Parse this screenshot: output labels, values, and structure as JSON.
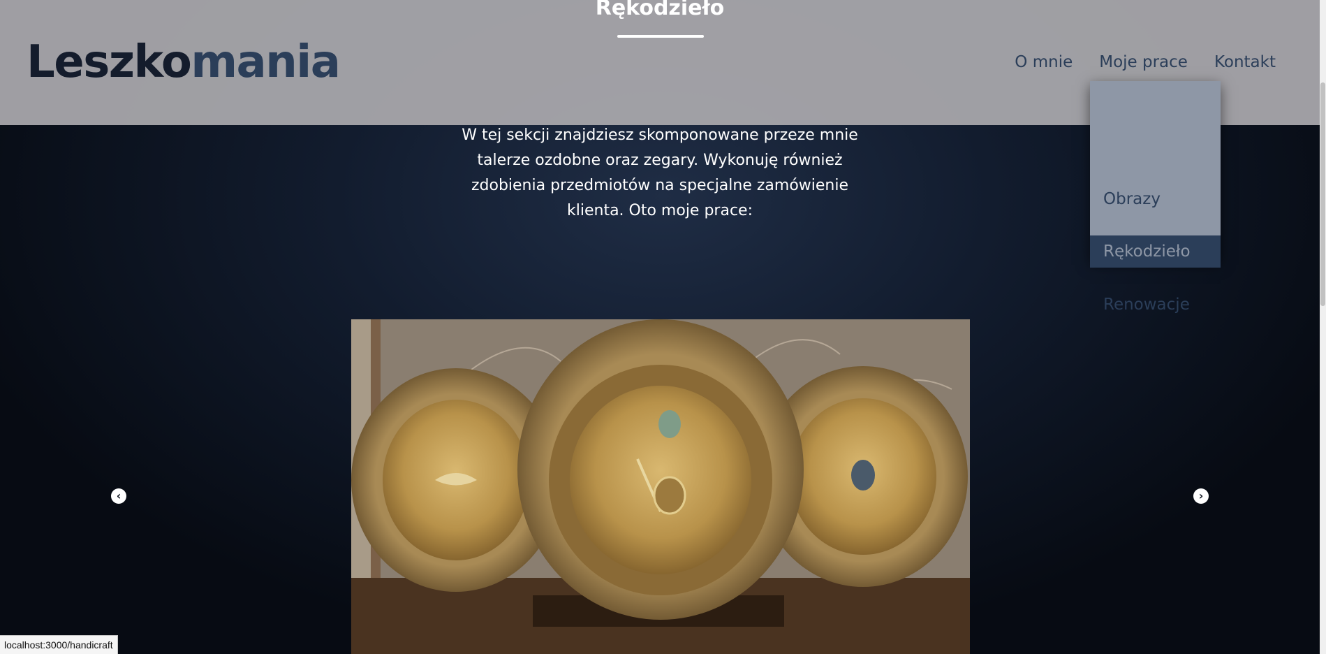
{
  "header": {
    "logo_part1": "Leszko",
    "logo_part2": "mania",
    "nav": [
      "O mnie",
      "Moje prace",
      "Kontakt"
    ]
  },
  "section": {
    "title": "Rękodzieło",
    "intro": "W tej sekcji znajdziesz skomponowane przeze mnie talerze ozdobne oraz zegary. Wykonuję również zdobienia przedmiotów na specjalne zamówienie klienta. Oto moje prace:"
  },
  "dropdown": {
    "items": [
      "Obrazy",
      "Rękodzieło",
      "Renowacje"
    ],
    "active": "Rękodzieło"
  },
  "carousel": {
    "prev_icon": "chevron-left-icon",
    "next_icon": "chevron-right-icon"
  },
  "status_bar": {
    "url": "localhost:3000/handicraft"
  },
  "colors": {
    "logo_dark": "#141c2c",
    "accent": "#2b3e59",
    "header_bg": "#a8a6ab",
    "dropdown_bg": "#8e97a6"
  }
}
